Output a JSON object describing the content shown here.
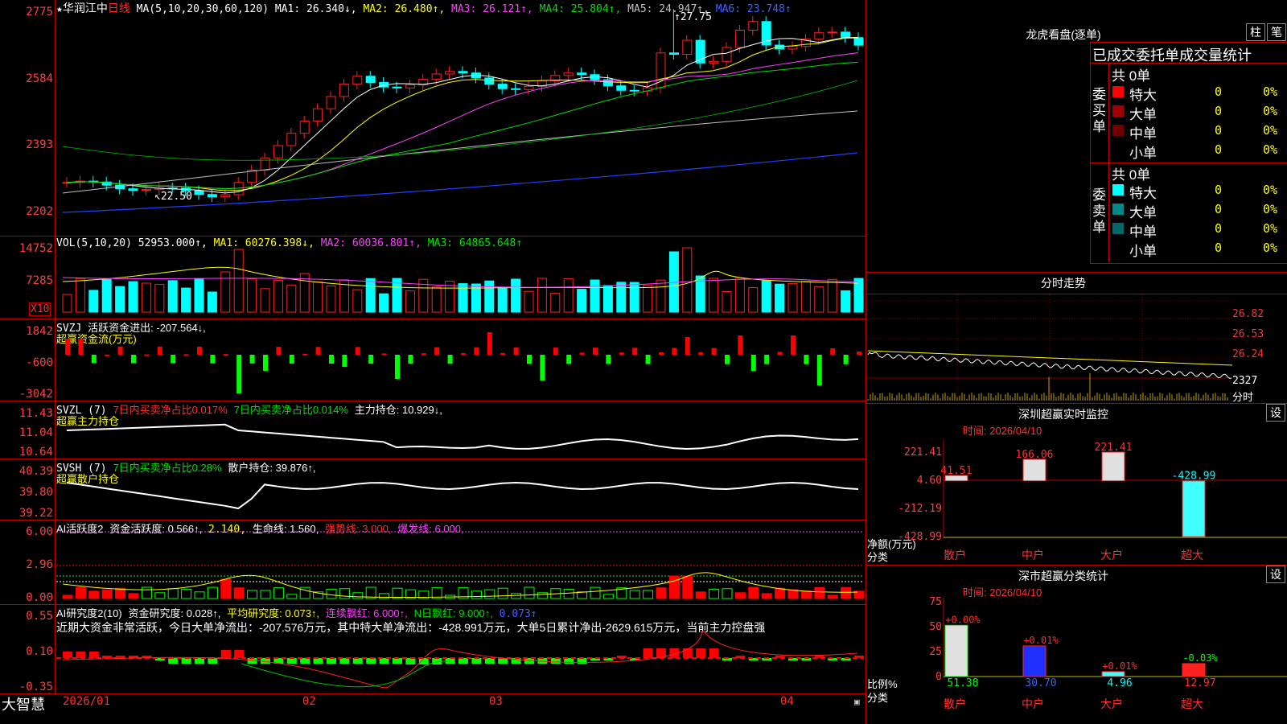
{
  "stock": {
    "star": "★",
    "name": "华润江中",
    "period": "日线",
    "ma_spec": "MA(5,10,20,30,60,120)",
    "ma1": "MA1: 26.340↓,",
    "ma2": "MA2: 26.480↑,",
    "ma3": "MA3: 26.121↑,",
    "ma4": "MA4: 25.804↑,",
    "ma5": "MA5: 24.947↑,",
    "ma6": "MA6: 23.748↑",
    "high_label": "27.75",
    "low_label": "22.50"
  },
  "axis": {
    "price": [
      "2775",
      "2584",
      "2393",
      "2202"
    ],
    "vol": [
      "14752",
      "7285"
    ],
    "vol_unit": "X10",
    "svzj": [
      "1842",
      "-600",
      "-3042"
    ],
    "svzl": [
      "11.43",
      "11.04",
      "10.64"
    ],
    "svsh": [
      "40.39",
      "39.80",
      "39.22"
    ],
    "ai1": [
      "6.00",
      "2.96",
      "0.00"
    ],
    "ai2": [
      "0.55",
      "0.10",
      "-0.35"
    ]
  },
  "legends": {
    "vol": {
      "spec": "VOL(5,10,20)",
      "v": "52953.000↑,",
      "ma1": "MA1: 60276.398↓,",
      "ma2": "MA2: 60036.801↑,",
      "ma3": "MA3: 64865.648↑"
    },
    "svzj": {
      "spec": "SVZJ",
      "text": "活跃资金进出: -207.564↓,",
      "sub": "超赢资金流(万元)"
    },
    "svzl": {
      "spec": "SVZL (7)",
      "a": "7日内买卖净占比0.017%",
      "b": "7日内买卖净占比0.014%",
      "c": "主力持仓: 10.929↓,",
      "sub": "超赢主力持仓"
    },
    "svsh": {
      "spec": "SVSH (7)",
      "a": "7日内买卖净占比0.28%",
      "c": "散户持仓: 39.876↑,",
      "sub": "超赢散户持仓"
    },
    "ai1": {
      "spec": "AI活跃度2",
      "a": "资金活跃度: 0.566↑,",
      "b": "2.140,",
      "c": "生命线: 1.560,",
      "d": "强势线: 3.000,",
      "e": "爆发线: 6.000,"
    },
    "ai2": {
      "spec": "AI研究度2(10)",
      "a": "资金研究度: 0.028↑,",
      "b": "平均研究度: 0.073↑,",
      "c": "连续飘红: 6.000↑,",
      "d": "N日飘红: 9.000↑,",
      "e": "0.073↑",
      "note": "近期大资金非常活跃，今日大单净流出：-207.576万元，其中特大单净流出：-428.991万元，大单5日累计净出-2629.615万元，当前主力控盘强"
    }
  },
  "xaxis": [
    "2026/01",
    "02",
    "03",
    "04"
  ],
  "footer": {
    "brand": "大智慧"
  },
  "longhu": {
    "title": "龙虎看盘(逐单)",
    "btn1": "柱",
    "btn2": "笔",
    "header": "已成交委托单成交量统计",
    "buy_label": "委买单",
    "sell_label": "委卖单",
    "buy_total": "共 0单",
    "sell_total": "共 0单",
    "buy_rows": [
      {
        "name": "特大",
        "n": "0",
        "p": "0%",
        "color": "#ff0000"
      },
      {
        "name": "大单",
        "n": "0",
        "p": "0%",
        "color": "#a00000"
      },
      {
        "name": "中单",
        "n": "0",
        "p": "0%",
        "color": "#700000"
      },
      {
        "name": "小单",
        "n": "0",
        "p": "0%",
        "color": ""
      }
    ],
    "sell_rows": [
      {
        "name": "特大",
        "n": "0",
        "p": "0%",
        "color": "#00ffff"
      },
      {
        "name": "大单",
        "n": "0",
        "p": "0%",
        "color": "#008888"
      },
      {
        "name": "中单",
        "n": "0",
        "p": "0%",
        "color": "#006868"
      },
      {
        "name": "小单",
        "n": "0",
        "p": "0%",
        "color": ""
      }
    ]
  },
  "fenshi": {
    "title": "分时走势",
    "prices": [
      "26.82",
      "26.53",
      "26.24"
    ],
    "vol": "2327",
    "vol_label": "分时"
  },
  "sz_monitor": {
    "title": "深圳超赢实时监控",
    "btn": "设",
    "time": "时间: 2026/04/10",
    "axis": [
      "221.41",
      "4.60",
      "-212.19",
      "-428.99"
    ],
    "ylabel": "净额(万元)",
    "xlabel": "分类",
    "cats": [
      "散户",
      "中户",
      "大户",
      "超大"
    ],
    "values": [
      41.51,
      166.06,
      221.41,
      -428.99
    ],
    "value_labels": [
      "41.51",
      "166.06",
      "221.41",
      "-428.99"
    ]
  },
  "sz_class": {
    "title": "深市超赢分类统计",
    "btn": "设",
    "time": "时间: 2026/04/10",
    "axis": [
      "75",
      "50",
      "25",
      "0"
    ],
    "ylabel": "比例%",
    "xlabel": "分类",
    "cats": [
      "散户",
      "中户",
      "大户",
      "超大"
    ],
    "values": [
      51.38,
      30.7,
      4.96,
      12.97
    ],
    "changes": [
      "+0.00%",
      "+0.01%",
      "+0.01%",
      "-0.03%"
    ]
  }
}
